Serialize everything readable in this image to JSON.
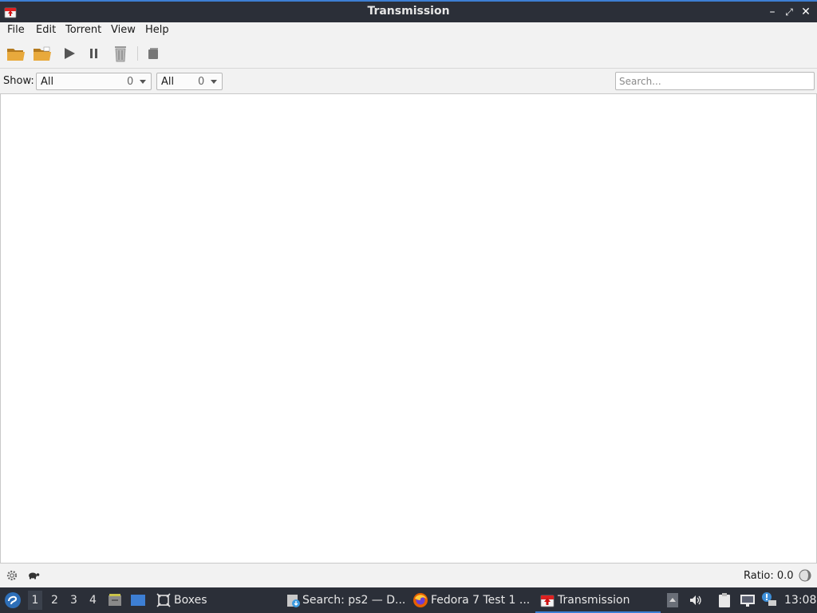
{
  "window": {
    "title": "Transmission",
    "controls": {
      "minimize": "–",
      "maximize": "⤢",
      "close": "✕"
    }
  },
  "menubar": {
    "items": [
      "File",
      "Edit",
      "Torrent",
      "View",
      "Help"
    ]
  },
  "toolbar": {
    "buttons": [
      "open-torrent-icon",
      "open-url-icon",
      "start-icon",
      "pause-icon",
      "remove-icon",
      "properties-icon"
    ]
  },
  "filter": {
    "show_label": "Show:",
    "activity": {
      "value": "All",
      "count": "0"
    },
    "tracker": {
      "value": "All",
      "count": "0"
    },
    "search_placeholder": "Search..."
  },
  "statusbar": {
    "ratio": "Ratio: 0.0"
  },
  "taskbar": {
    "workspaces": [
      "1",
      "2",
      "3",
      "4"
    ],
    "active_workspace": "1",
    "tasks": [
      {
        "label": "Boxes",
        "icon": "boxes-icon"
      },
      {
        "label": "Search: ps2 — D...",
        "icon": "download-icon"
      },
      {
        "label": "Fedora 7 Test 1 ...",
        "icon": "firefox-icon"
      },
      {
        "label": "Transmission",
        "icon": "transmission-icon"
      }
    ],
    "clock": "13:08"
  },
  "colors": {
    "titlebar_bg": "#2b2f38",
    "accent": "#3d7fd4",
    "chrome_bg": "#f2f2f2",
    "folder": "#e2a53a"
  }
}
